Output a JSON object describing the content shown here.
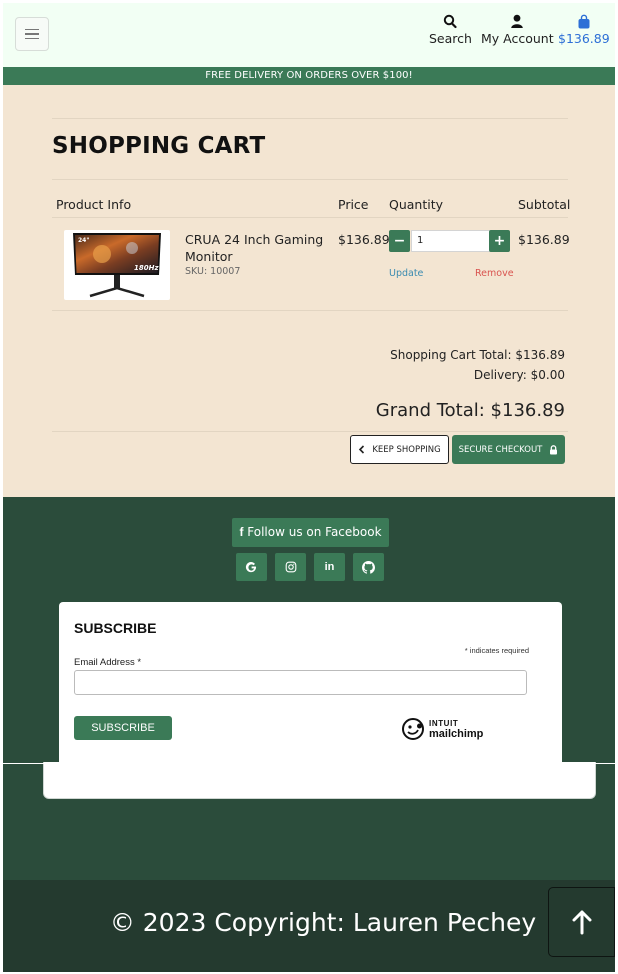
{
  "header": {
    "menu_icon": "hamburger-icon",
    "nav": [
      {
        "label": "Search",
        "icon": "search-icon"
      },
      {
        "label": "My Account",
        "icon": "user-icon"
      },
      {
        "label": "$136.89",
        "icon": "shopping-bag-icon"
      }
    ]
  },
  "banner": {
    "text": "FREE DELIVERY ON ORDERS OVER $100!"
  },
  "cart": {
    "title": "SHOPPING CART",
    "columns": {
      "product": "Product Info",
      "price": "Price",
      "quantity": "Quantity",
      "subtotal": "Subtotal"
    },
    "items": [
      {
        "name": "CRUA 24 Inch Gaming Monitor",
        "sku": "SKU: 10007",
        "price": "$136.89",
        "quantity": "1",
        "subtotal": "$136.89",
        "update": "Update",
        "remove": "Remove",
        "thumb_label_size": "24\"",
        "thumb_label_hz": "180Hz"
      }
    ],
    "summary": {
      "cart_total": "Shopping Cart Total: $136.89",
      "delivery": "Delivery: $0.00",
      "grand_total": "Grand Total: $136.89"
    },
    "keep_shopping": "KEEP SHOPPING",
    "secure_checkout": "SECURE CHECKOUT"
  },
  "footer": {
    "facebook": "Follow us on Facebook",
    "social_icons": [
      "google-icon",
      "instagram-icon",
      "linkedin-icon",
      "github-icon"
    ],
    "subscribe": {
      "title": "SUBSCRIBE",
      "required_note": "* indicates required",
      "email_label": "Email Address *",
      "email_value": "",
      "button": "SUBSCRIBE",
      "brand_top": "INTUIT",
      "brand_bottom": "mailchimp"
    },
    "copyright": "© 2023 Copyright: Lauren Pechey",
    "back_to_top_icon": "arrow-up-icon"
  },
  "colors": {
    "brand_green": "#3b7a57",
    "footer_green": "#2b4c3b",
    "cart_bg": "#f3e5d2",
    "header_bg": "#f2fff4",
    "bag_blue": "#2d6fd6"
  }
}
